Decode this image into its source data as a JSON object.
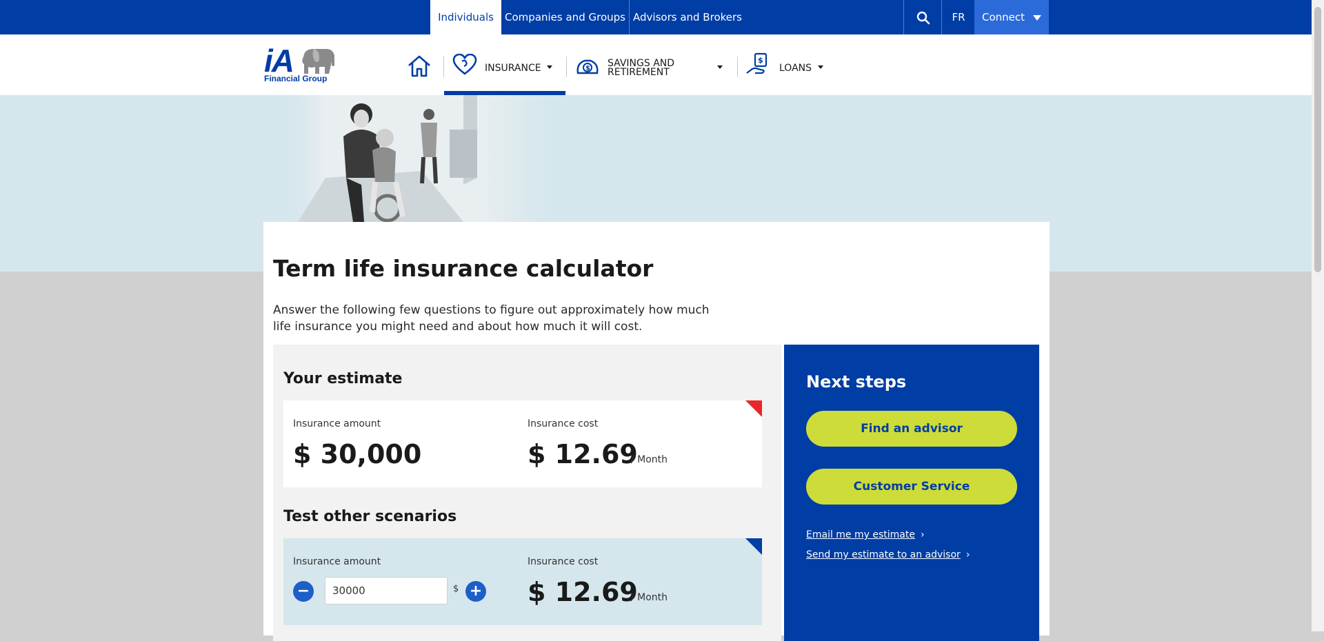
{
  "topbar": {
    "tabs": [
      "Individuals",
      "Companies and Groups",
      "Advisors and Brokers"
    ],
    "search_icon": "search-icon",
    "lang": "FR",
    "connect": "Connect"
  },
  "logo": {
    "brand": "iA",
    "tagline": "Financial Group"
  },
  "nav": {
    "home_icon": "home-icon",
    "insurance": "INSURANCE",
    "savings_line1": "SAVINGS AND",
    "savings_line2": "RETIREMENT",
    "loans": "LOANS"
  },
  "page": {
    "title": "Term life insurance calculator",
    "intro": "Answer the following few questions to figure out approximately how much life insurance you might need and about how much it will cost."
  },
  "estimate": {
    "heading": "Your estimate",
    "amount_label": "Insurance amount",
    "amount_value": "$ 30,000",
    "cost_label": "Insurance cost",
    "cost_value": "$ 12.69",
    "cost_period": "/ Month"
  },
  "scenarios": {
    "heading": "Test other scenarios",
    "amount_label": "Insurance amount",
    "amount_input": "30000",
    "currency": "$",
    "minus": "−",
    "plus": "+",
    "cost_label": "Insurance cost",
    "cost_value": "$ 12.69",
    "cost_period": "/ Month"
  },
  "next_steps": {
    "title": "Next steps",
    "buttons": [
      "Find an advisor",
      "Customer Service"
    ],
    "links": [
      "Email me my estimate",
      "Send my estimate to an advisor"
    ]
  },
  "colors": {
    "brand_blue": "#003da5",
    "accent_lime": "#cddc38",
    "accent_red": "#e8262c",
    "hero_bg": "#d5e7ed"
  }
}
